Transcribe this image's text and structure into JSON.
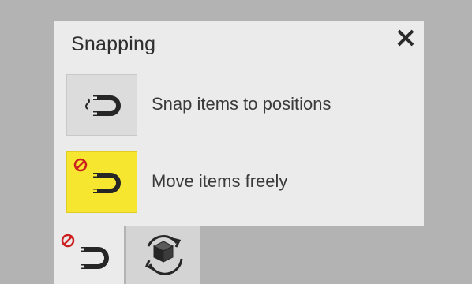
{
  "panel": {
    "title": "Snapping",
    "close_icon": "close-icon",
    "options": [
      {
        "label": "Snap items to positions",
        "icon": "snap-magnet-icon",
        "selected": false,
        "color": "#dcdcdc"
      },
      {
        "label": "Move items freely",
        "icon": "free-move-magnet-icon",
        "selected": true,
        "color": "#f7e62f"
      }
    ]
  },
  "toolbar": {
    "tabs": [
      {
        "icon": "magnet-disabled-icon",
        "active": true
      },
      {
        "icon": "rotate-cube-icon",
        "active": false
      }
    ]
  },
  "colors": {
    "background": "#b3b3b3",
    "panel": "#ebebeb",
    "highlight": "#f7e62f",
    "no_sign": "#cc1f1f",
    "icon_dark": "#262626"
  }
}
